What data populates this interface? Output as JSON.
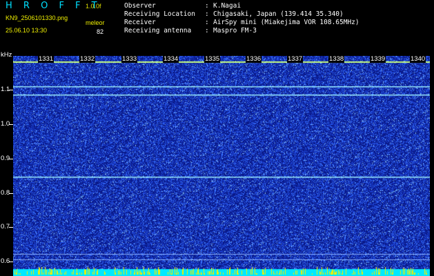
{
  "app": {
    "title": "H R O F F T",
    "version": "1.0.0f"
  },
  "file": {
    "name": "KN9_2506101330.png",
    "timestamp": "25.06.10 13:30"
  },
  "station": {
    "label": "meleor",
    "count": "82"
  },
  "info": [
    {
      "label": "Observer",
      "sep": ":",
      "value": "K.Nagai"
    },
    {
      "label": "Receiving Location",
      "sep": ":",
      "value": "Chigasaki, Japan (139.414 35.340)"
    },
    {
      "label": "Receiver",
      "sep": ":",
      "value": "AirSpy mini (Miakejima VOR 108.65MHz)"
    },
    {
      "label": "Receiving antenna",
      "sep": ":",
      "value": "Maspro FM-3"
    }
  ],
  "y_axis": {
    "unit": "kHz",
    "ticks": [
      "1.1",
      "1.0",
      "0.9",
      "0.8",
      "0.7",
      "0.6"
    ]
  },
  "time_labels": [
    "1331",
    "1332",
    "1333",
    "1334",
    "1335",
    "1336",
    "1337",
    "1338",
    "1339",
    "1340"
  ],
  "chart_data": {
    "type": "heatmap",
    "ylabel": "kHz",
    "ylim": [
      0.585,
      1.175
    ],
    "y_ticks": [
      1.1,
      1.0,
      0.9,
      0.8,
      0.7,
      0.6
    ],
    "x_tick_labels": [
      "1331",
      "1332",
      "1333",
      "1334",
      "1335",
      "1336",
      "1337",
      "1338",
      "1339",
      "1340"
    ],
    "horizontal_lines_khz": [
      1.093,
      1.072,
      0.852
    ],
    "colors": {
      "background": "#0a1a8a",
      "noise": "#3060ff",
      "line": "#9cf0ff",
      "carrier": "#f0f000",
      "floor": "#00e8ff"
    }
  }
}
